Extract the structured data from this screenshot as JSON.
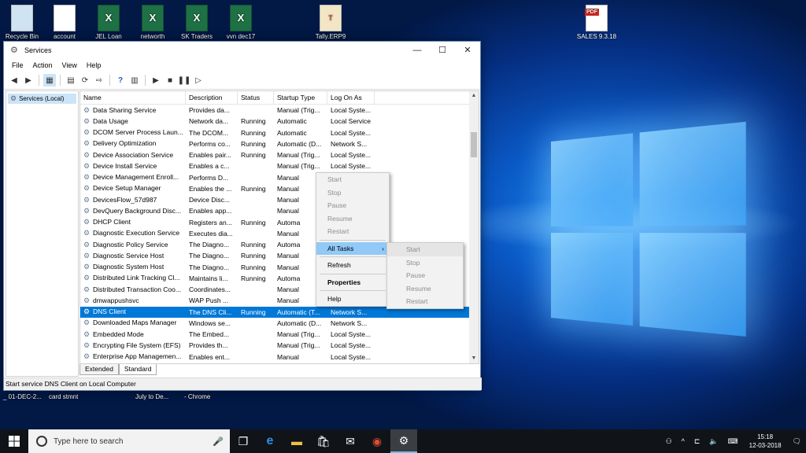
{
  "desktop": {
    "icons": [
      {
        "label": "Recycle Bin",
        "glyph": "🗑"
      },
      {
        "label": "account",
        "glyph": "W"
      },
      {
        "label": "JEL Loan",
        "glyph": "X"
      },
      {
        "label": "networth",
        "glyph": "X"
      },
      {
        "label": "SK Traders",
        "glyph": "X"
      },
      {
        "label": "vvn dec17",
        "glyph": "X"
      },
      {
        "label": "Tally.ERP9",
        "glyph": "T"
      },
      {
        "label": "SALES 9.3.18",
        "glyph": "PDF"
      }
    ],
    "bottom_labels": [
      "_ 01-DEC-2...",
      "card stmnt",
      "July to De...",
      "- Chrome"
    ]
  },
  "window": {
    "title": "Services",
    "minimize": "—",
    "maximize": "☐",
    "close": "✕",
    "menu": [
      "File",
      "Action",
      "View",
      "Help"
    ],
    "tree_root": "Services (Local)",
    "columns": [
      "Name",
      "Description",
      "Status",
      "Startup Type",
      "Log On As"
    ],
    "rows": [
      [
        "Data Sharing Service",
        "Provides da...",
        "",
        "Manual (Trig...",
        "Local Syste..."
      ],
      [
        "Data Usage",
        "Network da...",
        "Running",
        "Automatic",
        "Local Service"
      ],
      [
        "DCOM Server Process Laun...",
        "The DCOM...",
        "Running",
        "Automatic",
        "Local Syste..."
      ],
      [
        "Delivery Optimization",
        "Performs co...",
        "Running",
        "Automatic (D...",
        "Network S..."
      ],
      [
        "Device Association Service",
        "Enables pair...",
        "Running",
        "Manual (Trig...",
        "Local Syste..."
      ],
      [
        "Device Install Service",
        "Enables a c...",
        "",
        "Manual (Trig...",
        "Local Syste..."
      ],
      [
        "Device Management Enroll...",
        "Performs D...",
        "",
        "Manual",
        ""
      ],
      [
        "Device Setup Manager",
        "Enables the ...",
        "Running",
        "Manual",
        ""
      ],
      [
        "DevicesFlow_57d987",
        "Device Disc...",
        "",
        "Manual",
        ""
      ],
      [
        "DevQuery Background Disc...",
        "Enables app...",
        "",
        "Manual",
        ""
      ],
      [
        "DHCP Client",
        "Registers an...",
        "Running",
        "Automa",
        ""
      ],
      [
        "Diagnostic Execution Service",
        "Executes dia...",
        "",
        "Manual",
        ""
      ],
      [
        "Diagnostic Policy Service",
        "The Diagno...",
        "Running",
        "Automa",
        ""
      ],
      [
        "Diagnostic Service Host",
        "The Diagno...",
        "Running",
        "Manual",
        ""
      ],
      [
        "Diagnostic System Host",
        "The Diagno...",
        "Running",
        "Manual",
        ""
      ],
      [
        "Distributed Link Tracking Cl...",
        "Maintains li...",
        "Running",
        "Automa",
        ""
      ],
      [
        "Distributed Transaction Coo...",
        "Coordinates...",
        "",
        "Manual",
        ""
      ],
      [
        "dmwappushsvc",
        "WAP Push ...",
        "",
        "Manual",
        ""
      ],
      [
        "DNS Client",
        "The DNS Cli...",
        "Running",
        "Automatic (T...",
        "Network S..."
      ],
      [
        "Downloaded Maps Manager",
        "Windows se...",
        "",
        "Automatic (D...",
        "Network S..."
      ],
      [
        "Embedded Mode",
        "The Embed...",
        "",
        "Manual (Trig...",
        "Local Syste..."
      ],
      [
        "Encrypting File System (EFS)",
        "Provides th...",
        "",
        "Manual (Trig...",
        "Local Syste..."
      ],
      [
        "Enterprise App Managemen...",
        "Enables ent...",
        "",
        "Manual",
        "Local Syste..."
      ]
    ],
    "selected_row": "DNS Client",
    "tabs": [
      "Extended",
      "Standard"
    ],
    "status": "Start service DNS Client on Local Computer"
  },
  "context_menu": {
    "items": [
      "Start",
      "Stop",
      "Pause",
      "Resume",
      "Restart",
      "All Tasks",
      "Refresh",
      "Properties",
      "Help"
    ],
    "submenu_arrow": "›"
  },
  "submenu": {
    "items": [
      "Start",
      "Stop",
      "Pause",
      "Resume",
      "Restart"
    ]
  },
  "taskbar": {
    "search_placeholder": "Type here to search",
    "time": "15:18",
    "date": "12-03-2018"
  }
}
